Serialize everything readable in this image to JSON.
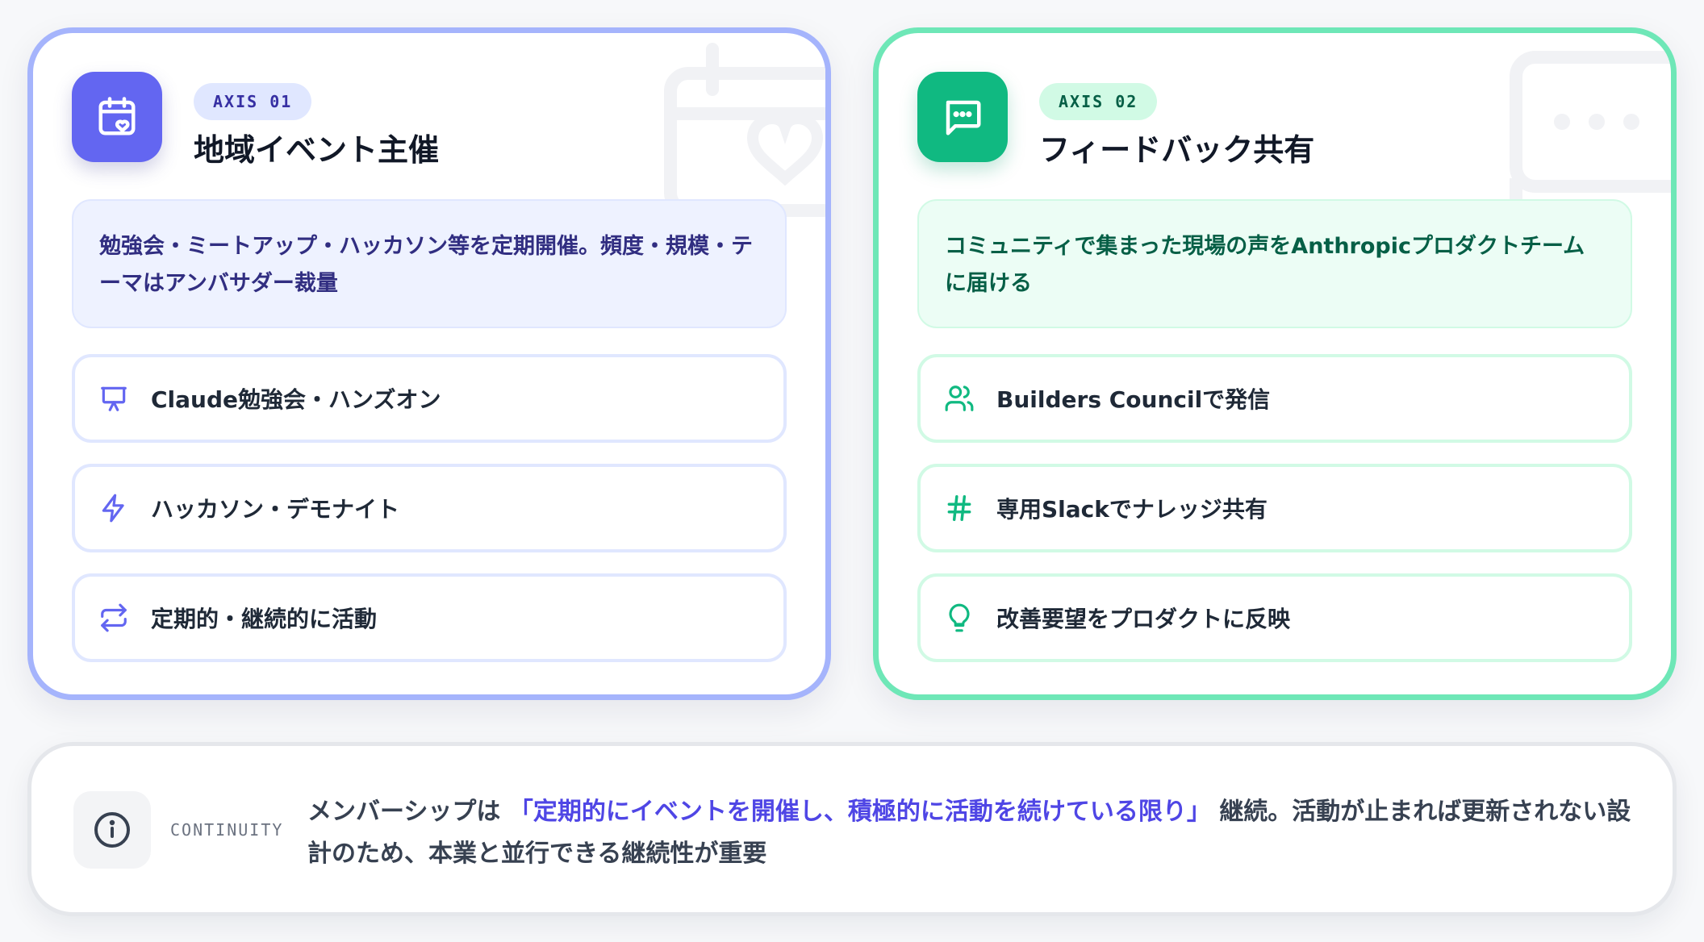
{
  "axis1": {
    "badge": "AXIS 01",
    "title": "地域イベント主催",
    "description": "勉強会・ミートアップ・ハッカソン等を定期開催。頻度・規模・テーマはアンバサダー裁量",
    "items": [
      {
        "label": "Claude勉強会・ハンズオン",
        "icon": "presentation-icon"
      },
      {
        "label": "ハッカソン・デモナイト",
        "icon": "lightning-icon"
      },
      {
        "label": "定期的・継続的に活動",
        "icon": "repeat-icon"
      }
    ],
    "accent": "#6366f1"
  },
  "axis2": {
    "badge": "AXIS 02",
    "title": "フィードバック共有",
    "description": "コミュニティで集まった現場の声をAnthropicプロダクトチームに届ける",
    "items": [
      {
        "label": "Builders Councilで発信",
        "icon": "users-icon"
      },
      {
        "label": "専用Slackでナレッジ共有",
        "icon": "hash-icon"
      },
      {
        "label": "改善要望をプロダクトに反映",
        "icon": "lightbulb-icon"
      }
    ],
    "accent": "#10b981"
  },
  "continuity": {
    "label": "CONTINUITY",
    "text_before": "メンバーシップは",
    "highlight": "「定期的にイベントを開催し、積極的に活動を続けている限り」",
    "text_after": "継続。活動が止まれば更新されない設計のため、本業と並行できる継続性が重要"
  }
}
